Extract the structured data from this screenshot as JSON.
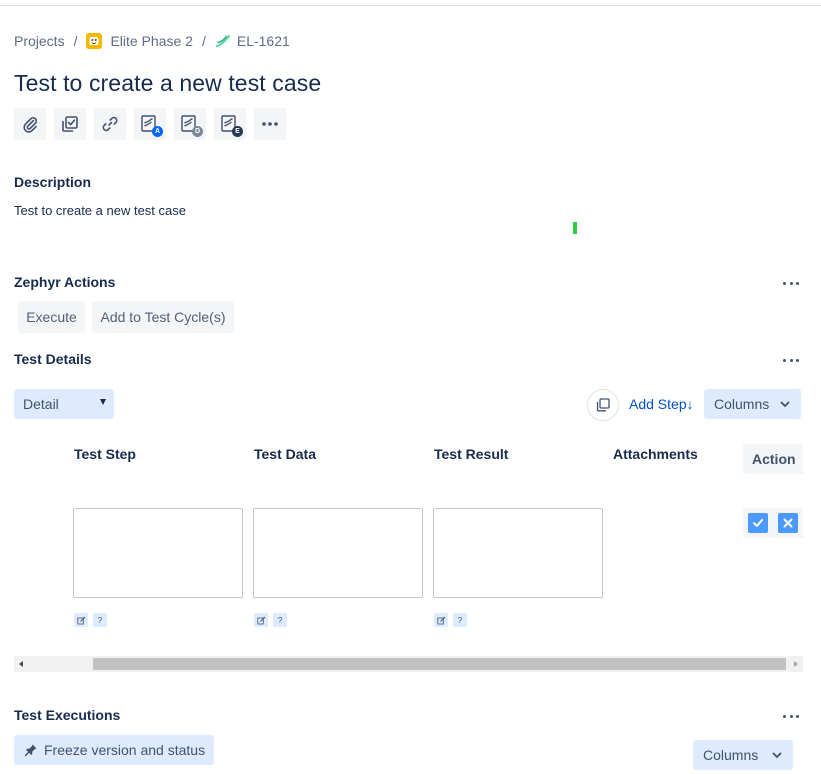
{
  "breadcrumb": {
    "projects": "Projects",
    "separator": "/",
    "project_name": "Elite Phase 2",
    "issue_key": "EL-1621"
  },
  "issue": {
    "title": "Test to create a new test case"
  },
  "toolbar": {
    "icons": [
      "paperclip-icon",
      "checkbox-icon",
      "link-icon",
      "zephyr-a-icon",
      "zephyr-d-icon",
      "zephyr-e-icon",
      "more-icon"
    ],
    "badges": {
      "a": "A",
      "d": "D",
      "e": "E"
    }
  },
  "description": {
    "heading": "Description",
    "text": "Test to create a new test case"
  },
  "zephyr_actions": {
    "heading": "Zephyr Actions",
    "execute_label": "Execute",
    "add_to_cycle_label": "Add to Test Cycle(s)"
  },
  "test_details": {
    "heading": "Test Details",
    "view_select": "Detail",
    "add_step_label": "Add Step↓",
    "columns_label": "Columns",
    "columns": {
      "test_step": "Test Step",
      "test_data": "Test Data",
      "test_result": "Test Result",
      "attachments": "Attachments",
      "action": "Action"
    },
    "mini_help": "?"
  },
  "test_executions": {
    "heading": "Test Executions",
    "freeze_label": "Freeze version and status",
    "columns_label": "Columns"
  },
  "colors": {
    "text_primary": "#172b4d",
    "link_blue": "#0052cc",
    "button_blue_light": "#deebff",
    "action_blue": "#4c9aff",
    "neutral_bg": "#f4f5f7"
  }
}
